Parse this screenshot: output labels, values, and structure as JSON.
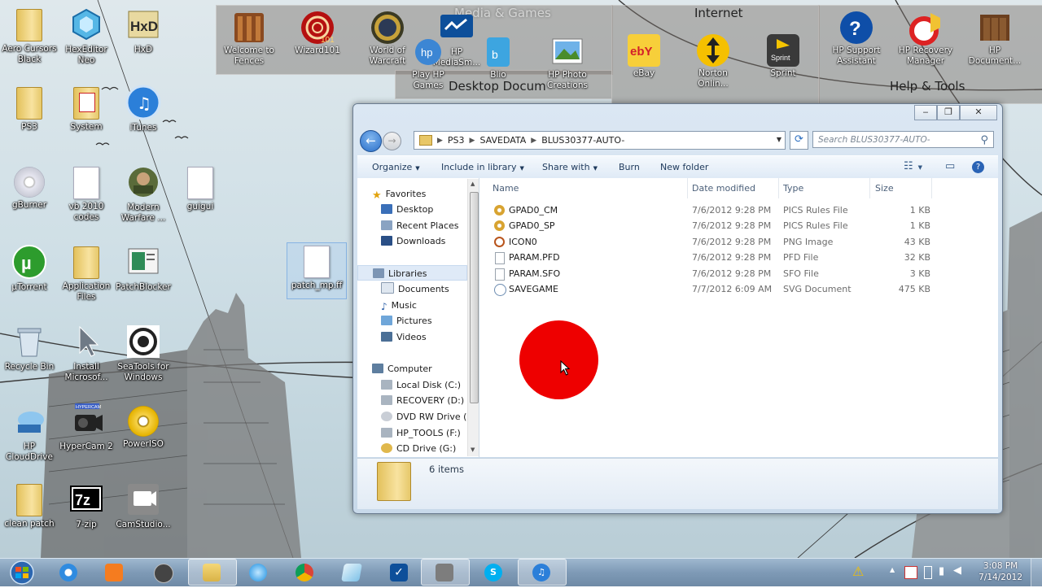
{
  "desktop": {
    "icons": [
      {
        "label": "Aero Cursors Black",
        "icon": "folder-icon"
      },
      {
        "label": "HexEditor Neo",
        "icon": "hexeditor-icon"
      },
      {
        "label": "HxD",
        "icon": "hxd-icon"
      },
      {
        "label": "PS3",
        "icon": "folder-icon"
      },
      {
        "label": "System",
        "icon": "pdf-folder-icon"
      },
      {
        "label": "iTunes",
        "icon": "itunes-icon"
      },
      {
        "label": "gBurner",
        "icon": "disc-icon"
      },
      {
        "label": "vb 2010 codes",
        "icon": "document-icon"
      },
      {
        "label": "Modern Warfare ...",
        "icon": "game-icon"
      },
      {
        "label": "guigui",
        "icon": "document-icon"
      },
      {
        "label": "µTorrent",
        "icon": "utorrent-icon"
      },
      {
        "label": "Application Files",
        "icon": "folder-icon"
      },
      {
        "label": "PatchBlocker",
        "icon": "app-icon"
      },
      {
        "label": "patch_mp.ff",
        "icon": "document-icon"
      },
      {
        "label": "Recycle Bin",
        "icon": "recycle-bin-icon"
      },
      {
        "label": "Install Microsof...",
        "icon": "installer-icon"
      },
      {
        "label": "SeaTools for Windows",
        "icon": "seatools-icon"
      },
      {
        "label": "HP CloudDrive",
        "icon": "cloud-icon"
      },
      {
        "label": "HyperCam 2",
        "icon": "hypercam-icon"
      },
      {
        "label": "PowerISO",
        "icon": "poweriso-icon"
      },
      {
        "label": "clean patch",
        "icon": "folder-icon"
      },
      {
        "label": "7-zip",
        "icon": "7zip-icon"
      },
      {
        "label": "CamStudio...",
        "icon": "camstudio-icon"
      }
    ],
    "hypercam_badge": "HYPERCAM",
    "sevenzip_text": "7z",
    "fences": {
      "media_title": "Media & Games",
      "internet_title": "Internet",
      "help_title": "Help & Tools",
      "desktop_docs_title": "Desktop Docum",
      "items": [
        {
          "label": "Welcome to Fences",
          "icon": "fences-icon"
        },
        {
          "label": "Wizard101",
          "icon": "wizard101-icon"
        },
        {
          "label": "World of Warcraft",
          "icon": "wow-icon"
        },
        {
          "label": "HP MediaSm...",
          "icon": "hp-mediasmart-icon"
        },
        {
          "label": "Play HP Games",
          "icon": "hp-games-icon"
        },
        {
          "label": "Blio",
          "icon": "blio-icon"
        },
        {
          "label": "HP Photo Creations",
          "icon": "hp-photo-icon"
        },
        {
          "label": "eBay",
          "icon": "ebay-icon"
        },
        {
          "label": "Norton Onlin...",
          "icon": "norton-icon"
        },
        {
          "label": "Sprint",
          "icon": "sprint-icon"
        },
        {
          "label": "HP Support Assistant",
          "icon": "help-icon"
        },
        {
          "label": "HP Recovery Manager",
          "icon": "recovery-icon"
        },
        {
          "label": "HP Document...",
          "icon": "hp-document-icon"
        }
      ],
      "wizard_badge": "101",
      "ebay_text": "ebY",
      "sprint_text": "Sprint"
    }
  },
  "explorer": {
    "breadcrumb": [
      "PS3",
      "SAVEDATA",
      "BLUS30377-AUTO-"
    ],
    "search_placeholder": "Search BLUS30377-AUTO-",
    "toolbar": {
      "organize": "Organize",
      "include": "Include in library",
      "share": "Share with",
      "burn": "Burn",
      "new_folder": "New folder"
    },
    "nav": {
      "favorites": "Favorites",
      "desktop": "Desktop",
      "recent": "Recent Places",
      "downloads": "Downloads",
      "libraries": "Libraries",
      "documents": "Documents",
      "music": "Music",
      "pictures": "Pictures",
      "videos": "Videos",
      "computer": "Computer",
      "drives": [
        "Local Disk (C:)",
        "RECOVERY (D:)",
        "DVD RW Drive (E:",
        "HP_TOOLS (F:)",
        "CD Drive (G:)"
      ]
    },
    "columns": {
      "name": "Name",
      "date": "Date modified",
      "type": "Type",
      "size": "Size"
    },
    "files": [
      {
        "name": "GPAD0_CM",
        "date": "7/6/2012 9:28 PM",
        "type": "PICS Rules File",
        "size": "1 KB",
        "icon": "pics-rules-icon"
      },
      {
        "name": "GPAD0_SP",
        "date": "7/6/2012 9:28 PM",
        "type": "PICS Rules File",
        "size": "1 KB",
        "icon": "pics-rules-icon"
      },
      {
        "name": "ICON0",
        "date": "7/6/2012 9:28 PM",
        "type": "PNG Image",
        "size": "43 KB",
        "icon": "png-image-icon"
      },
      {
        "name": "PARAM.PFD",
        "date": "7/6/2012 9:28 PM",
        "type": "PFD File",
        "size": "32 KB",
        "icon": "file-icon"
      },
      {
        "name": "PARAM.SFO",
        "date": "7/6/2012 9:28 PM",
        "type": "SFO File",
        "size": "3 KB",
        "icon": "file-icon"
      },
      {
        "name": "SAVEGAME",
        "date": "7/7/2012 6:09 AM",
        "type": "SVG Document",
        "size": "475 KB",
        "icon": "svg-document-icon"
      }
    ],
    "status": "6 items"
  },
  "taskbar": {
    "clock_time": "3:08 PM",
    "clock_date": "7/14/2012",
    "apps": [
      "internet-explorer-icon",
      "media-player-icon",
      "hp-icon",
      "file-explorer-icon",
      "blue-orb-icon",
      "chrome-icon",
      "generic-app-icon",
      "checkmark-app-icon",
      "camstudio-icon",
      "skype-icon",
      "itunes-icon"
    ]
  },
  "colors": {
    "accent_red": "#ee0000",
    "window_chrome": "#dbe7f3",
    "taskbar": "#7e9ab6"
  }
}
